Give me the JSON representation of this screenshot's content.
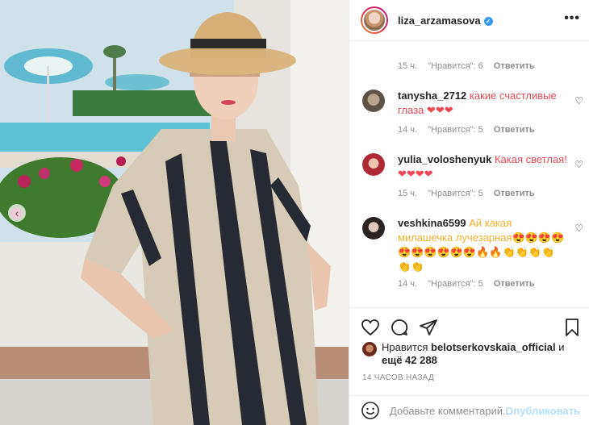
{
  "post": {
    "username": "liza_arzamasova",
    "verified_icon": "verified-badge-icon",
    "more_label": "•••"
  },
  "comments": [
    {
      "partial": true,
      "time": "15 ч.",
      "likes": "\"Нравится\": 6",
      "reply": "Ответить"
    },
    {
      "username": "tanysha_2712",
      "text": "какие счастливые глаза ❤❤❤",
      "time": "14 ч.",
      "likes": "\"Нравится\": 5",
      "reply": "Ответить"
    },
    {
      "username": "yulia_voloshenyuk",
      "text": "Какая светлая! ❤❤❤❤",
      "time": "15 ч.",
      "likes": "\"Нравится\": 5",
      "reply": "Ответить"
    },
    {
      "username": "veshkina6599",
      "text": "Ай какая милашечка лучезарная😍😍😍😍😍😍😍😍😍😍🔥🔥👏👏👏👏👏👏",
      "time": "14 ч.",
      "likes": "\"Нравится\": 5",
      "reply": "Ответить"
    }
  ],
  "likes": {
    "prefix": "Нравится",
    "user": "belotserkovskaia_official",
    "rest_prefix": "и",
    "count": "ещё 42 288"
  },
  "timestamp": "14 ЧАСОВ НАЗАД",
  "compose": {
    "placeholder": "Добавьте комментарий...",
    "publish": "Опубликовать"
  },
  "colors": {
    "heart": "#ed4956",
    "link_blue": "#3897f0",
    "publish_disabled": "#b2dffc",
    "meta_gray": "#8e8e8e"
  }
}
